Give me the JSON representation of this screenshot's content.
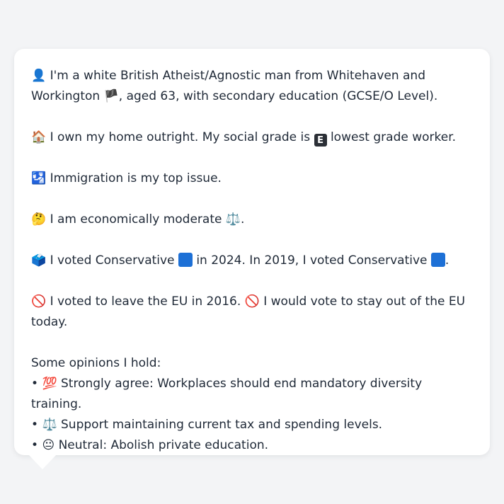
{
  "bubble": {
    "p1": {
      "icon": "👤",
      "line1": "I'm a white British Atheist/Agnostic man from Whitehaven and",
      "line2_a": "Workington",
      "flag": "🏴",
      "line2_b": ", aged 63, with secondary education (GCSE/O Level)."
    },
    "p2": {
      "icon": "🏠",
      "text_a": "I own my home outright. My social grade is",
      "grade_letter": "E",
      "text_b": "lowest grade worker."
    },
    "p3": {
      "icon": "🛂",
      "text": "Immigration is my top issue."
    },
    "p4": {
      "icon": "🤔",
      "text": "I am economically moderate",
      "scale": "⚖️",
      "end": "."
    },
    "p5": {
      "icon": "🗳️",
      "text_a": "I voted Conservative",
      "text_b": "in 2024. In 2019, I voted Conservative",
      "end": "."
    },
    "p6": {
      "icon": "🚫",
      "text_a": "I voted to leave the EU in 2016.",
      "icon2": "🚫",
      "text_b": "I would vote to stay out of the EU",
      "text_c": "today."
    },
    "opinions": {
      "heading": "Some opinions I hold:",
      "items": [
        {
          "bullet": "•",
          "icon": "💯",
          "text": "Strongly agree: Workplaces should end mandatory diversity training."
        },
        {
          "bullet": "•",
          "icon": "⚖️",
          "text": "Support maintaining current tax and spending levels."
        },
        {
          "bullet": "•",
          "icon": "😐",
          "text": "Neutral: Abolish private education."
        }
      ]
    }
  },
  "colors": {
    "page_background": "#f3f4f6",
    "bubble_background": "#ffffff",
    "text": "#1f2937",
    "conservative_blue": "#1d70d6"
  }
}
